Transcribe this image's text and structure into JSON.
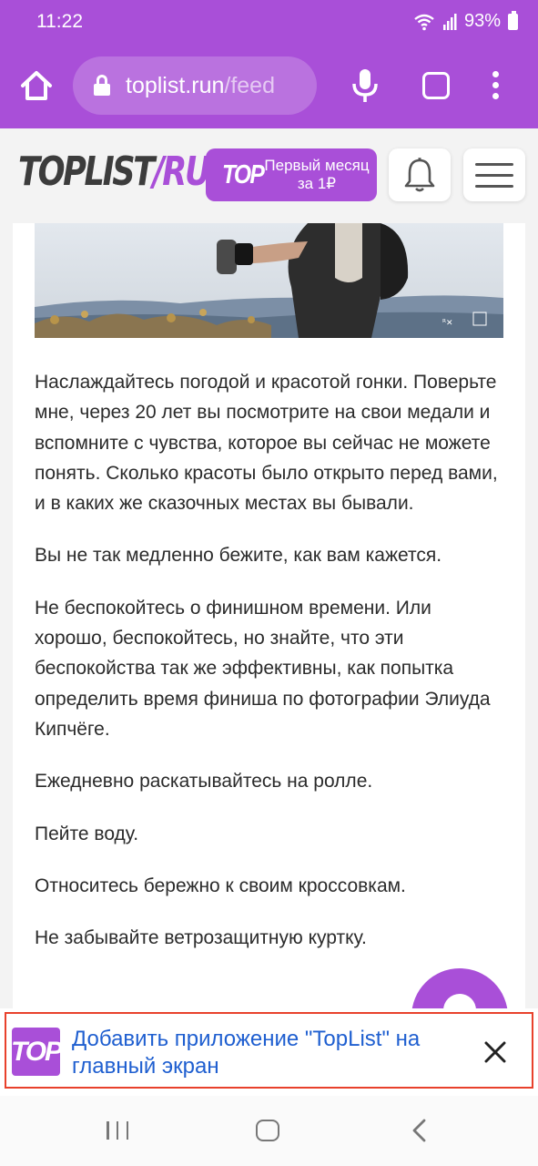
{
  "status_bar": {
    "time": "11:22",
    "battery": "93%",
    "icons": [
      "wifi-icon",
      "signal-icon",
      "battery-icon"
    ]
  },
  "browser": {
    "url_host": "toplist.run",
    "url_path": "/feed",
    "icons": [
      "home-icon",
      "lock-icon",
      "mic-icon",
      "tabs-icon",
      "more-icon"
    ]
  },
  "site_header": {
    "logo_part1": "TOPLIST",
    "logo_part2": "/RUN",
    "promo_logo": "TOP",
    "promo_text": "Первый месяц за 1₽",
    "icons": [
      "bell-icon",
      "menu-icon"
    ]
  },
  "article": {
    "paragraphs": [
      "Наслаждайтесь погодой и красотой гонки. Поверьте мне, через 20 лет вы посмотрите на свои медали и вспомните с чувства, которое вы сейчас не можете понять. Сколько красоты было открыто перед вами, и в каких же сказочных местах вы бывали.",
      "Вы не так медленно бежите, как вам кажется.",
      "Не беспокойтесь о финишном времени. Или хорошо, беспокойтесь, но знайте, что эти беспокойства так же эффективны, как попытка определить время финиша по фотографии Элиуда Кипчёге.",
      "Ежедневно раскатывайтесь на ролле.",
      "Пейте воду.",
      "Относитесь бережно к своим кроссовкам.",
      "Не забывайте ветрозащитную куртку."
    ]
  },
  "install_banner": {
    "icon_text": "TOP",
    "text": "Добавить приложение \"TopList\" на главный экран"
  },
  "colors": {
    "brand": "#a94fd8",
    "link": "#1f5fd0",
    "highlight": "#e8412c"
  }
}
